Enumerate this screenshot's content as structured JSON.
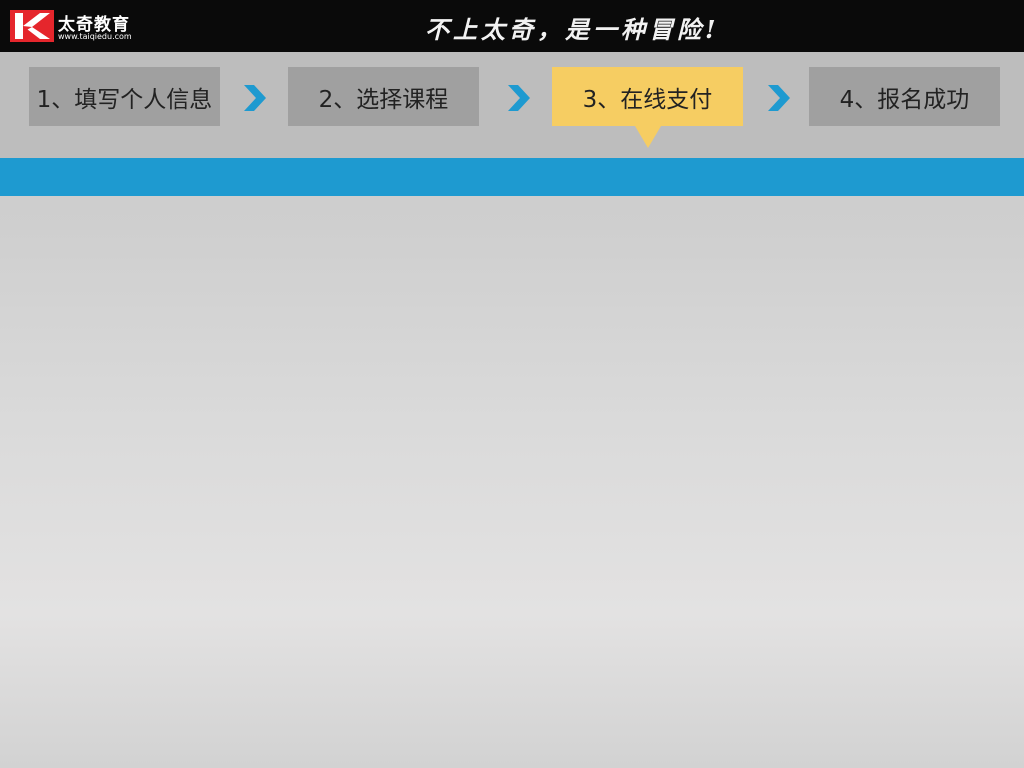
{
  "brand": {
    "name": "太奇教育",
    "url": "www.taiqiedu.com",
    "colors": {
      "mark_red": "#e5262c",
      "mark_white": "#ffffff"
    }
  },
  "header": {
    "slogan": "不上太奇，是一种冒险!"
  },
  "steps": [
    {
      "label": "1、填写个人信息",
      "active": false
    },
    {
      "label": "2、选择课程",
      "active": false
    },
    {
      "label": "3、在线支付",
      "active": true
    },
    {
      "label": "4、报名成功",
      "active": false
    }
  ],
  "colors": {
    "active_step": "#f6cd62",
    "inactive_step": "#a0a0a0",
    "arrow": "#1e9ad0",
    "bar": "#1e9ad0",
    "topbar": "#0a0a0a"
  },
  "icons": {
    "logo": "taiqi-logo-icon",
    "step_arrow": "chevron-right-icon"
  }
}
